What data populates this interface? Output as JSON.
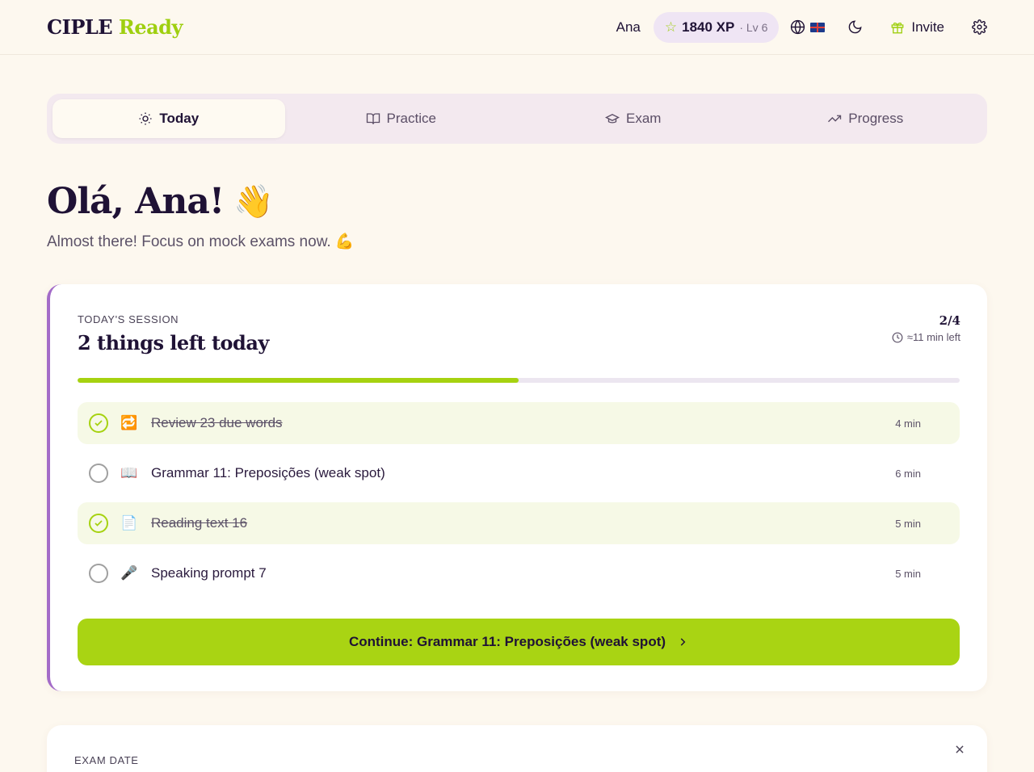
{
  "brand": {
    "part1": "CIPLE",
    "part2": "Ready"
  },
  "header": {
    "user_name": "Ana",
    "xp": "1840 XP",
    "level": "· Lv 6",
    "invite_label": "Invite"
  },
  "tabs": [
    {
      "label": "Today",
      "icon": "sun-icon",
      "active": true
    },
    {
      "label": "Practice",
      "icon": "book-icon",
      "active": false
    },
    {
      "label": "Exam",
      "icon": "graduation-cap-icon",
      "active": false
    },
    {
      "label": "Progress",
      "icon": "trending-up-icon",
      "active": false
    }
  ],
  "greeting": {
    "title": "Olá, Ana!",
    "emoji": "👋",
    "subtitle": "Almost there! Focus on mock exams now.",
    "subtitle_emoji": "💪"
  },
  "session": {
    "label": "TODAY'S SESSION",
    "title": "2 things left today",
    "count": "2/4",
    "time_left": "≈11 min left",
    "progress": 0.5,
    "tasks": [
      {
        "label": "Review 23 due words",
        "emoji": "🔁",
        "duration": "4 min",
        "done": true
      },
      {
        "label": "Grammar 11: Preposições (weak spot)",
        "emoji": "📖",
        "duration": "6 min",
        "done": false
      },
      {
        "label": "Reading text 16",
        "emoji": "📄",
        "duration": "5 min",
        "done": true
      },
      {
        "label": "Speaking prompt 7",
        "emoji": "🎤",
        "duration": "5 min",
        "done": false
      }
    ],
    "cta_label": "Continue: Grammar 11: Preposições (weak spot)"
  },
  "exam_card": {
    "label": "EXAM DATE"
  },
  "colors": {
    "accent": "#a9d413",
    "brand_purple": "#1f1235",
    "card_border": "#a36bc8"
  }
}
